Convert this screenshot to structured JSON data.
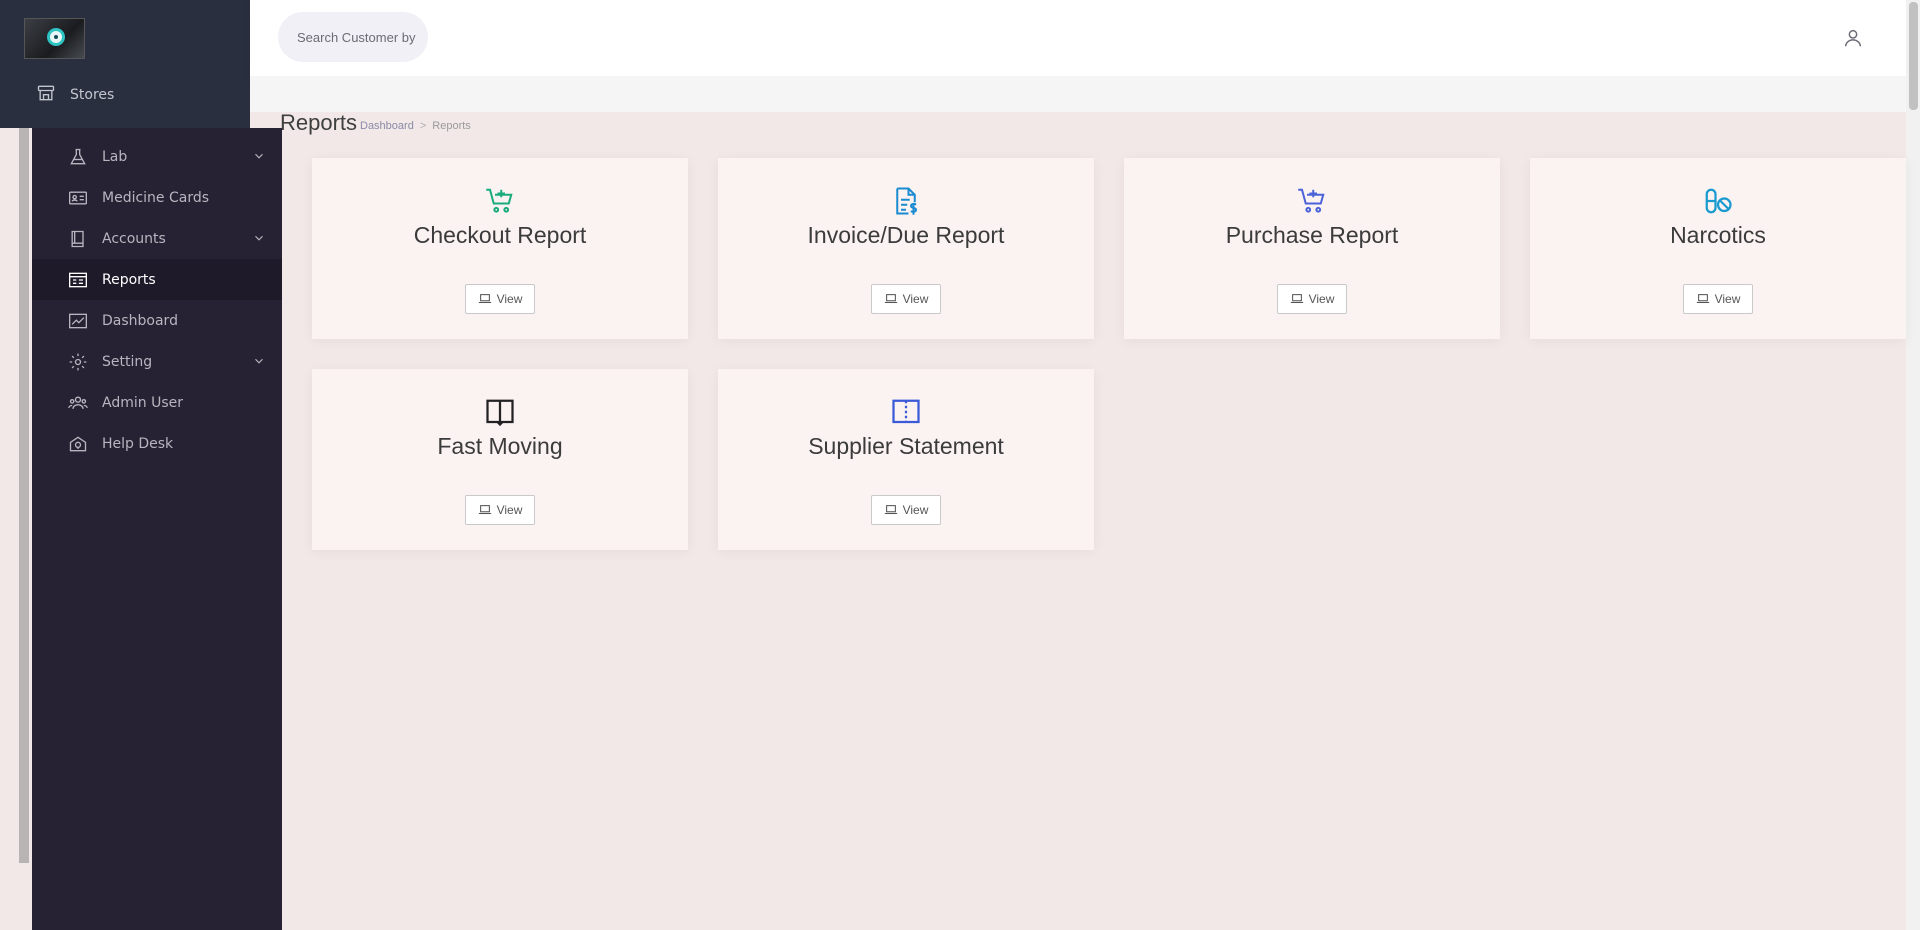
{
  "header": {
    "search_placeholder": "Search Customer by"
  },
  "sidebar": {
    "top_item": {
      "label": "Stores",
      "icon": "store-icon"
    },
    "items": [
      {
        "label": "Lab",
        "icon": "flask-icon",
        "has_submenu": true
      },
      {
        "label": "Medicine Cards",
        "icon": "id-card-icon",
        "has_submenu": false
      },
      {
        "label": "Accounts",
        "icon": "book-icon",
        "has_submenu": true
      },
      {
        "label": "Reports",
        "icon": "report-icon",
        "has_submenu": false,
        "active": true
      },
      {
        "label": "Dashboard",
        "icon": "chart-icon",
        "has_submenu": false
      },
      {
        "label": "Setting",
        "icon": "gear-icon",
        "has_submenu": true
      },
      {
        "label": "Admin User",
        "icon": "users-icon",
        "has_submenu": false
      },
      {
        "label": "Help Desk",
        "icon": "help-icon",
        "has_submenu": false
      }
    ]
  },
  "page": {
    "title": "Reports",
    "breadcrumb": [
      "Dashboard",
      "Reports"
    ]
  },
  "cards": [
    {
      "title": "Checkout Report",
      "icon": "cart-plus-icon",
      "icon_color": "#1aab7c",
      "button": "View"
    },
    {
      "title": "Invoice/Due Report",
      "icon": "invoice-icon",
      "icon_color": "#1a8bd0",
      "button": "View"
    },
    {
      "title": "Purchase Report",
      "icon": "cart-plus-icon",
      "icon_color": "#4a63d8",
      "button": "View"
    },
    {
      "title": "Narcotics",
      "icon": "pills-icon",
      "icon_color": "#1a9bd0",
      "button": "View"
    },
    {
      "title": "Fast Moving",
      "icon": "open-book-icon",
      "icon_color": "#222222",
      "button": "View"
    },
    {
      "title": "Supplier Statement",
      "icon": "open-book-icon",
      "icon_color": "#3a5ad8",
      "button": "View"
    }
  ]
}
